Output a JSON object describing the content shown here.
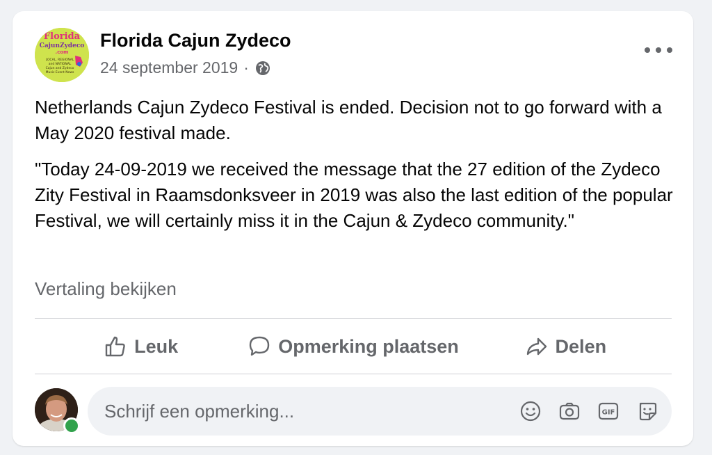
{
  "post": {
    "author": "Florida Cajun Zydeco",
    "date": "24 september 2019",
    "separator": "·",
    "paragraphs": [
      "Netherlands Cajun Zydeco Festival is ended. Decision not to go forward with a May 2020 festival made.",
      "\"Today 24-09-2019 we received the message that the 27 edition of the Zydeco Zity Festival in Raamsdonksveer in 2019 was also the last edition of the popular Festival, we will certainly miss it in the Cajun & Zydeco community.\""
    ],
    "translate_label": "Vertaling bekijken"
  },
  "logo": {
    "line1": "Florida",
    "line2": "CajunZydeco",
    "line3": ".com",
    "line4": "LOCAL, REGIONAL",
    "line5": "and NATIONAL",
    "line6": "Cajun and Zydeco",
    "line7": "Music Event News"
  },
  "actions": {
    "like_label": "Leuk",
    "comment_label": "Opmerking plaatsen",
    "share_label": "Delen"
  },
  "comment": {
    "placeholder": "Schrijf een opmerking..."
  },
  "icons": {
    "privacy": "globe-icon",
    "more": "more-options-icon",
    "like": "thumbs-up-icon",
    "comment": "speech-bubble-icon",
    "share": "share-arrow-icon",
    "emoji": "smiley-icon",
    "camera": "camera-icon",
    "gif": "gif-icon",
    "sticker": "sticker-icon"
  },
  "colors": {
    "background": "#f0f2f5",
    "card": "#ffffff",
    "secondary_text": "#65676b",
    "online": "#31a24c"
  }
}
